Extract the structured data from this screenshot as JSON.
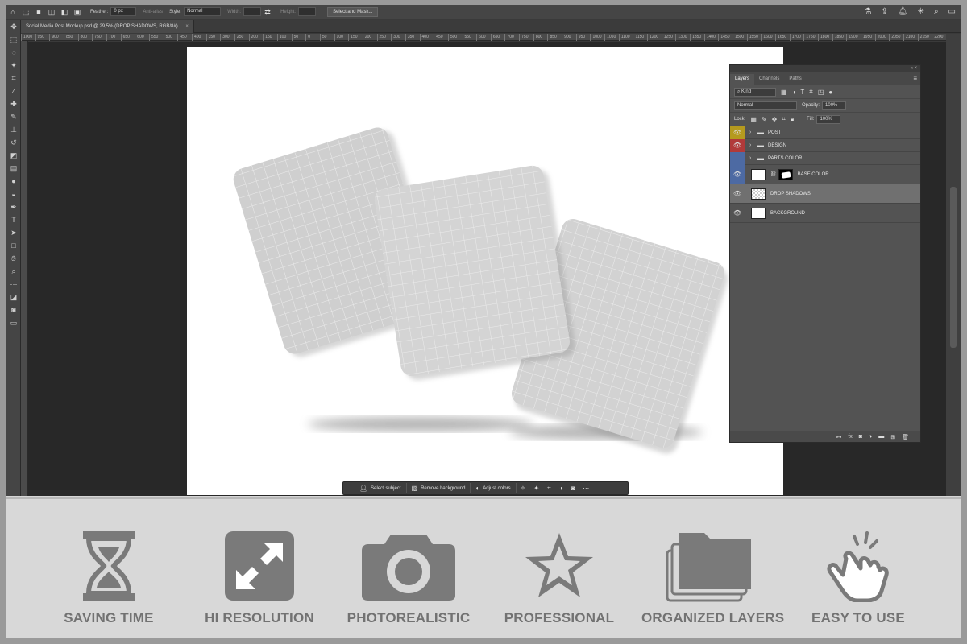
{
  "options_bar": {
    "feather_label": "Feather:",
    "feather_value": "0 px",
    "antialias_label": "Anti-alias",
    "style_label": "Style:",
    "style_value": "Normal",
    "width_label": "Width:",
    "height_label": "Height:",
    "select_mask_button": "Select and Mask..."
  },
  "document_tab": {
    "title": "Social Media Post Mockup.psd @ 29,5% (DROP SHADOWS, RGB/8#)",
    "close": "×"
  },
  "ruler": {
    "ticks": [
      "1000",
      "950",
      "900",
      "850",
      "800",
      "750",
      "700",
      "650",
      "600",
      "550",
      "500",
      "450",
      "400",
      "350",
      "300",
      "250",
      "200",
      "150",
      "100",
      "50",
      "0",
      "50",
      "100",
      "150",
      "200",
      "250",
      "300",
      "350",
      "400",
      "450",
      "500",
      "550",
      "600",
      "650",
      "700",
      "750",
      "800",
      "850",
      "900",
      "950",
      "1000",
      "1050",
      "1100",
      "1150",
      "1200",
      "1250",
      "1300",
      "1350",
      "1400",
      "1450",
      "1500",
      "1550",
      "1600",
      "1650",
      "1700",
      "1750",
      "1800",
      "1850",
      "1900",
      "1950",
      "2000",
      "2050",
      "2100",
      "2150",
      "2200"
    ]
  },
  "contextual_bar": {
    "select_subject": "Select subject",
    "remove_background": "Remove background",
    "adjust_colors": "Adjust colors"
  },
  "layers_panel": {
    "tabs": [
      "Layers",
      "Channels",
      "Paths"
    ],
    "active_tab": "Layers",
    "filter_kind": "Kind",
    "blend_mode": "Normal",
    "opacity_label": "Opacity:",
    "opacity_value": "100%",
    "lock_label": "Lock:",
    "fill_label": "Fill:",
    "fill_value": "100%",
    "layers": [
      {
        "name": "POST",
        "type": "group",
        "color": "#b59a1e",
        "visible": true
      },
      {
        "name": "DESIGN",
        "type": "group",
        "color": "#b13a3a",
        "visible": true
      },
      {
        "name": "PARTS COLOR",
        "type": "group",
        "color": "#4d6aa3",
        "visible": false
      },
      {
        "name": "BASE COLOR",
        "type": "layer-mask",
        "color": "#4d6aa3",
        "visible": true
      },
      {
        "name": "DROP SHADOWS",
        "type": "transparent",
        "color": "",
        "visible": true,
        "selected": true
      },
      {
        "name": "BACKGROUND",
        "type": "white",
        "color": "",
        "visible": true
      }
    ]
  },
  "features": [
    {
      "label": "SAVING TIME",
      "icon": "hourglass-icon"
    },
    {
      "label": "HI RESOLUTION",
      "icon": "expand-arrows-icon"
    },
    {
      "label": "PHOTOREALISTIC",
      "icon": "camera-icon"
    },
    {
      "label": "PROFESSIONAL",
      "icon": "star-icon"
    },
    {
      "label": "ORGANIZED LAYERS",
      "icon": "stacked-folders-icon"
    },
    {
      "label": "EASY TO USE",
      "icon": "tap-hand-icon"
    }
  ],
  "colors": {
    "feature_icon": "#7a7a7a",
    "feature_label": "#727272",
    "card_fill": "#cfcfcf",
    "grid_line": "#ececec"
  }
}
